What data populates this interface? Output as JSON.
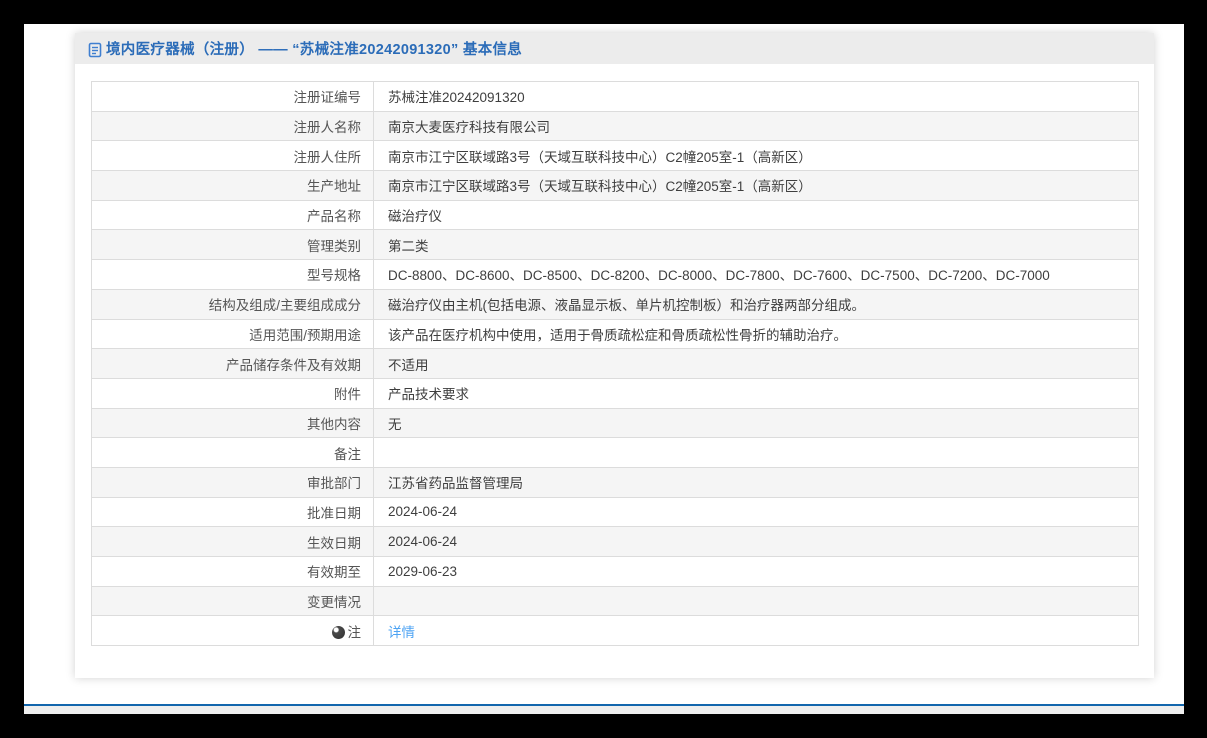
{
  "colors": {
    "frame": "#000000",
    "title_blue": "#2b6cb8",
    "link_blue": "#4da3f3",
    "footer_line_blue": "#1266ad",
    "zebra_row": "#f5f5f5",
    "title_bar_bg": "#ececec"
  },
  "header": {
    "icon": "document-icon",
    "title": "境内医疗器械（注册） —— “苏械注准20242091320” 基本信息"
  },
  "table": {
    "rows": [
      {
        "label": "注册证编号",
        "value": "苏械注准20242091320"
      },
      {
        "label": "注册人名称",
        "value": "南京大麦医疗科技有限公司"
      },
      {
        "label": "注册人住所",
        "value": "南京市江宁区联域路3号（天域互联科技中心）C2幢205室-1（高新区）"
      },
      {
        "label": "生产地址",
        "value": "南京市江宁区联域路3号（天域互联科技中心）C2幢205室-1（高新区）"
      },
      {
        "label": "产品名称",
        "value": "磁治疗仪"
      },
      {
        "label": "管理类别",
        "value": "第二类"
      },
      {
        "label": "型号规格",
        "value": "DC-8800、DC-8600、DC-8500、DC-8200、DC-8000、DC-7800、DC-7600、DC-7500、DC-7200、DC-7000"
      },
      {
        "label": "结构及组成/主要组成成分",
        "value": "磁治疗仪由主机(包括电源、液晶显示板、单片机控制板）和治疗器两部分组成。"
      },
      {
        "label": "适用范围/预期用途",
        "value": "该产品在医疗机构中使用，适用于骨质疏松症和骨质疏松性骨折的辅助治疗。"
      },
      {
        "label": "产品储存条件及有效期",
        "value": "不适用"
      },
      {
        "label": "附件",
        "value": "产品技术要求"
      },
      {
        "label": "其他内容",
        "value": "无"
      },
      {
        "label": "备注",
        "value": ""
      },
      {
        "label": "审批部门",
        "value": "江苏省药品监督管理局"
      },
      {
        "label": "批准日期",
        "value": "2024-06-24"
      },
      {
        "label": "生效日期",
        "value": "2024-06-24"
      },
      {
        "label": "有效期至",
        "value": "2029-06-23"
      },
      {
        "label": "变更情况",
        "value": ""
      },
      {
        "label": "注",
        "value": "详情",
        "icon": "note-icon",
        "link": true
      }
    ]
  }
}
